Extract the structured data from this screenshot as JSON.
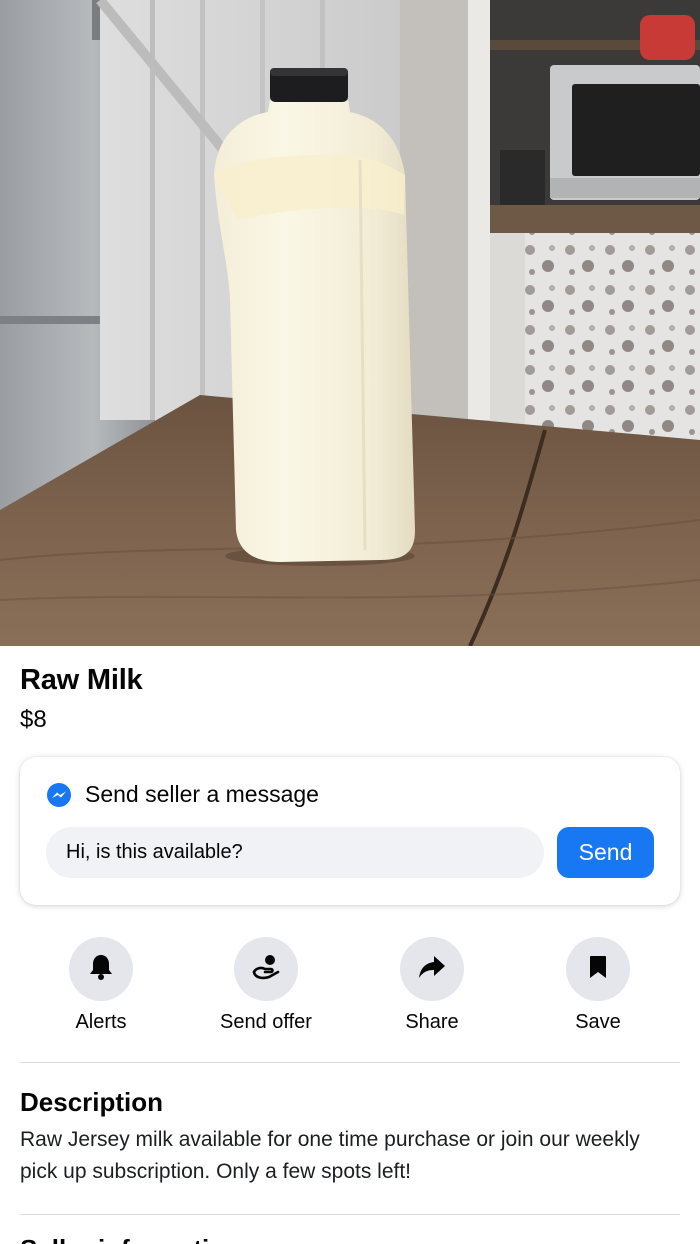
{
  "listing": {
    "title": "Raw Milk",
    "price": "$8"
  },
  "message_card": {
    "heading": "Send seller a message",
    "heading_icon": "messenger-icon",
    "input_value": "Hi, is this available?",
    "send_label": "Send",
    "accent_color": "#1877f2"
  },
  "actions": [
    {
      "label": "Alerts",
      "icon": "bell-icon"
    },
    {
      "label": "Send offer",
      "icon": "offer-hand-icon"
    },
    {
      "label": "Share",
      "icon": "share-arrow-icon"
    },
    {
      "label": "Save",
      "icon": "bookmark-icon"
    }
  ],
  "description": {
    "heading": "Description",
    "text": "Raw Jersey milk available for one time purchase or join our weekly pick up subscription. Only a few spots left!"
  },
  "next_section": {
    "heading": "Seller information"
  }
}
